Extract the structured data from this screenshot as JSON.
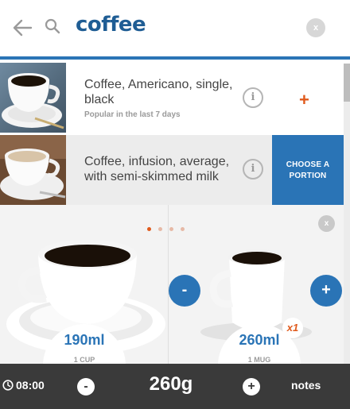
{
  "search": {
    "query": "coffee",
    "clear_label": "x"
  },
  "results": [
    {
      "title": "Coffee, Americano, single, black",
      "subtitle": "Popular in the last 7 days",
      "info_label": "i",
      "add_label": "+"
    },
    {
      "title": "Coffee, infusion, average, with semi-skimmed milk",
      "info_label": "i",
      "action_label": "CHOOSE A PORTION"
    }
  ],
  "portions": {
    "close_label": "x",
    "decrement_label": "-",
    "increment_label": "+",
    "page_count": 4,
    "active_page": 1,
    "items": [
      {
        "volume": "190ml",
        "unit": "1 CUP"
      },
      {
        "volume": "260ml",
        "unit": "1 MUG",
        "multiplier": "x1"
      }
    ]
  },
  "footer": {
    "time": "08:00",
    "decrement_label": "-",
    "quantity": "260g",
    "increment_label": "+",
    "notes_label": "notes"
  },
  "colors": {
    "brand_blue": "#2a74b6",
    "accent_orange": "#e05a1c",
    "footer_dark": "#3a3a3a"
  },
  "icons": [
    "back-arrow-icon",
    "search-icon",
    "clock-icon"
  ]
}
